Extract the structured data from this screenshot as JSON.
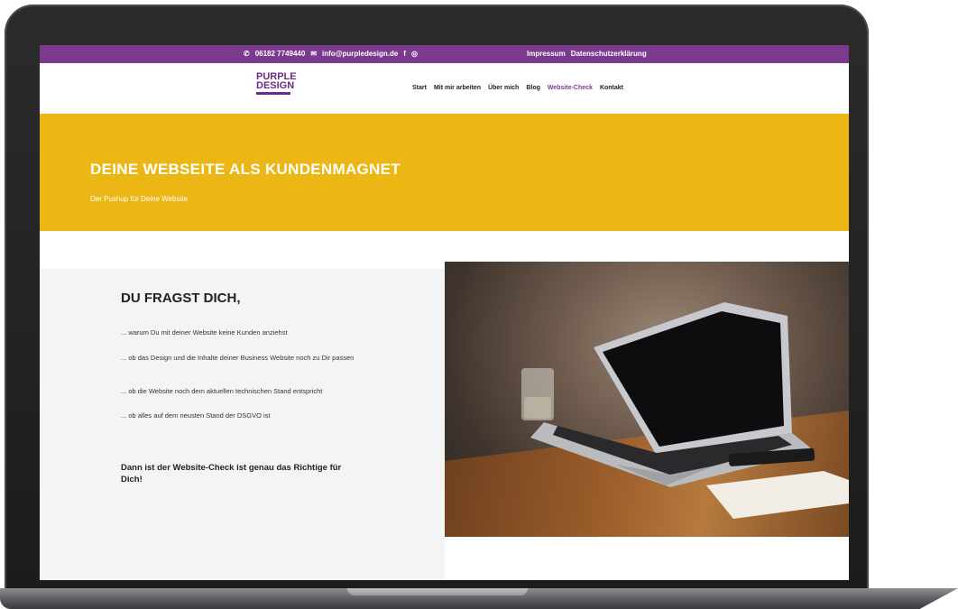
{
  "topbar": {
    "phone": "06182 7749440",
    "email": "info@purpledesign.de",
    "facebook_icon": "f",
    "instagram_icon": "◎",
    "links": [
      "Impressum",
      "Datenschutzerklärung"
    ]
  },
  "header": {
    "logo_line1": "PURPLE",
    "logo_line2": "DESIGN",
    "nav": [
      "Start",
      "Mit mir arbeiten",
      "Über mich",
      "Blog",
      "Website-Check",
      "Kontakt"
    ],
    "active_nav": "Website-Check"
  },
  "hero": {
    "title": "DEINE WEBSEITE ALS KUNDENMAGNET",
    "subtitle": "Der Pushup für Deine Website"
  },
  "content": {
    "title": "DU FRAGST DICH,",
    "items": [
      "... warum Du mit deiner Website keine Kunden anziehst",
      "... ob das Design und die Inhalte deiner Business Website noch zu Dir passen",
      "... ob die Website noch dem aktuellen technischen Stand entspricht",
      "... ob alles auf dem neusten Stand der DSGVO ist"
    ],
    "cta": "Dann ist der Website-Check ist genau das Richtige für Dich!"
  },
  "colors": {
    "purple": "#7b3a8e",
    "yellow": "#ecb714"
  }
}
